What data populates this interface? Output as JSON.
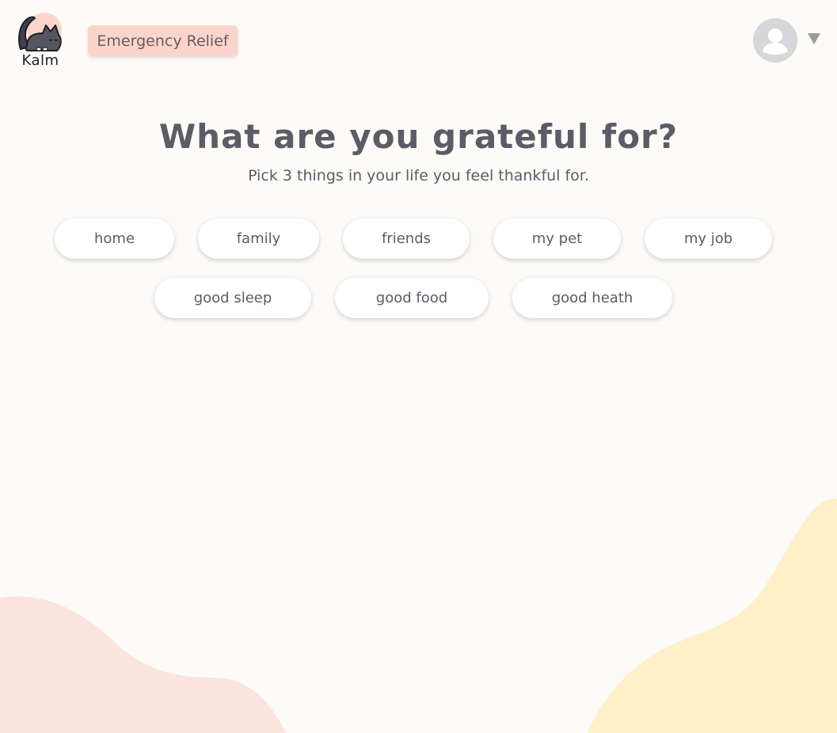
{
  "header": {
    "logo_text": "Kalm",
    "emergency_label": "Emergency Relief"
  },
  "main": {
    "title": "What are you grateful for?",
    "subtitle": "Pick 3 things in your life you feel thankful for.",
    "options": [
      "home",
      "family",
      "friends",
      "my pet",
      "my job",
      "good sleep",
      "good food",
      "good heath"
    ]
  },
  "colors": {
    "background": "#fdfbf8",
    "text": "#5b5c66",
    "emergency_bg": "#fbd5cc",
    "blob_pink": "#fce4df",
    "blob_yellow": "#fff0c9",
    "avatar_bg": "#d7d7d9"
  },
  "icons": {
    "logo": "cat-logo-icon",
    "avatar": "user-avatar-icon",
    "dropdown": "caret-down-icon"
  }
}
